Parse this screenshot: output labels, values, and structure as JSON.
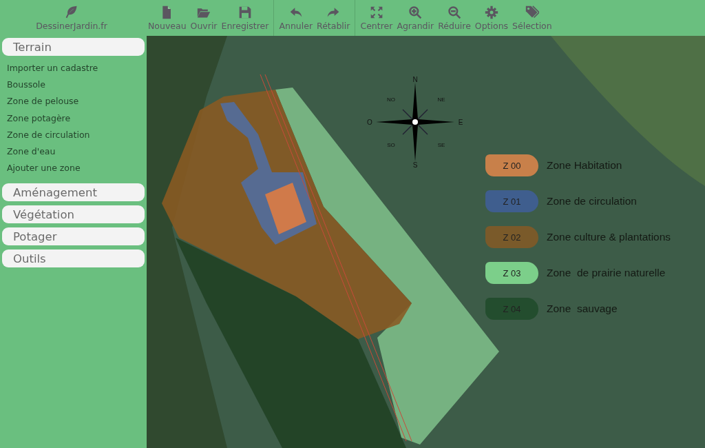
{
  "toolbar": {
    "brand": "DessinerJardin.fr",
    "groups": [
      [
        {
          "label": "Nouveau"
        },
        {
          "label": "Ouvrir"
        },
        {
          "label": "Enregistrer"
        }
      ],
      [
        {
          "label": "Annuler"
        },
        {
          "label": "Rétablir"
        }
      ],
      [
        {
          "label": "Centrer"
        },
        {
          "label": "Agrandir"
        },
        {
          "label": "Réduire"
        },
        {
          "label": "Options"
        },
        {
          "label": "Sélection"
        }
      ]
    ]
  },
  "sidebar": {
    "sections": [
      {
        "title": "Terrain",
        "items": [
          "Importer un cadastre",
          "Boussole",
          "Zone de pelouse",
          "Zone potagère",
          "Zone de circulation",
          "Zone d'eau",
          "Ajouter une zone"
        ]
      },
      {
        "title": "Aménagement"
      },
      {
        "title": "Végétation"
      },
      {
        "title": "Potager"
      },
      {
        "title": "Outils"
      }
    ]
  },
  "canvas": {
    "compass": {
      "n": "N",
      "ne": "NE",
      "e": "E",
      "se": "SE",
      "s": "S",
      "so": "SO",
      "o": "O",
      "no": "NO"
    },
    "legend": [
      {
        "code": "Z 00",
        "label": "Zone Habitation",
        "color": "#c8804a"
      },
      {
        "code": "Z 01",
        "label": "Zone de circulation",
        "color": "#3f5e8e"
      },
      {
        "code": "Z 02",
        "label": "Zone culture & plantations",
        "color": "#7a5a2a"
      },
      {
        "code": "Z 03",
        "label": "Zone  de prairie naturelle",
        "color": "#7ccf8a"
      },
      {
        "code": "Z 04",
        "label": "Zone  sauvage",
        "color": "#234d2e"
      }
    ]
  }
}
